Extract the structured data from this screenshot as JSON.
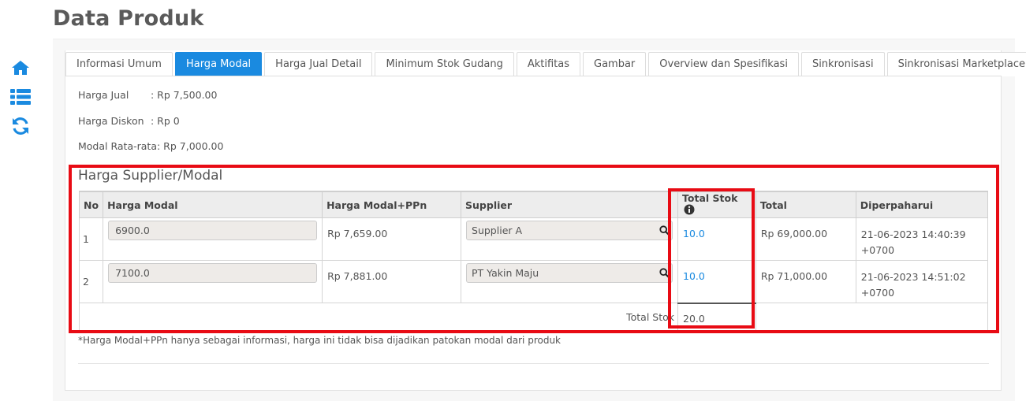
{
  "page": {
    "title": "Data Produk"
  },
  "sidebar": {
    "icons": [
      "home-icon",
      "list-icon",
      "refresh-icon"
    ]
  },
  "tabs": [
    {
      "label": "Informasi Umum",
      "active": false
    },
    {
      "label": "Harga Modal",
      "active": true
    },
    {
      "label": "Harga Jual Detail",
      "active": false
    },
    {
      "label": "Minimum Stok Gudang",
      "active": false
    },
    {
      "label": "Aktifitas",
      "active": false
    },
    {
      "label": "Gambar",
      "active": false
    },
    {
      "label": "Overview dan Spesifikasi",
      "active": false
    },
    {
      "label": "Sinkronisasi",
      "active": false
    },
    {
      "label": "Sinkronisasi Marketplace",
      "active": false
    }
  ],
  "info": {
    "harga_jual": {
      "label": "Harga Jual",
      "value": ": Rp 7,500.00"
    },
    "harga_diskon": {
      "label": "Harga Diskon",
      "value": ": Rp 0"
    },
    "modal": {
      "label": "Modal Rata-rata",
      "value": ": Rp 7,000.00"
    }
  },
  "section": {
    "title": "Harga Supplier/Modal"
  },
  "table": {
    "headers": {
      "no": "No",
      "harga_modal": "Harga Modal",
      "harga_ppn": "Harga Modal+PPn",
      "supplier": "Supplier",
      "total_stok": "Total Stok",
      "total": "Total",
      "diperbaharui": "Diperpaharui"
    },
    "rows": [
      {
        "no": "1",
        "harga_modal": "6900.0",
        "harga_ppn": "Rp 7,659.00",
        "supplier": "Supplier A",
        "total_stok": "10.0",
        "total": "Rp 69,000.00",
        "date1": "21-06-2023 14:40:39",
        "date2": "+0700"
      },
      {
        "no": "2",
        "harga_modal": "7100.0",
        "harga_ppn": "Rp 7,881.00",
        "supplier": "PT Yakin Maju",
        "total_stok": "10.0",
        "total": "Rp 71,000.00",
        "date1": "21-06-2023 14:51:02",
        "date2": "+0700"
      }
    ],
    "footer": {
      "label": "Total Stok",
      "value": "20.0"
    }
  },
  "footnote": "*Harga Modal+PPn hanya sebagai informasi, harga ini tidak bisa dijadikan patokan modal dari produk",
  "colors": {
    "accent": "#1a8ae0",
    "highlight": "#e80b14"
  }
}
